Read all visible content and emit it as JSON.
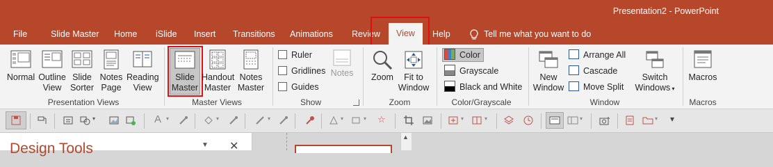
{
  "window": {
    "title": "Presentation2  -  PowerPoint"
  },
  "tabs": [
    "File",
    "Slide Master",
    "Home",
    "iSlide",
    "Insert",
    "Transitions",
    "Animations",
    "Review",
    "View",
    "Help"
  ],
  "tell_me": "Tell me what you want to do",
  "ribbon": {
    "presentation_views": {
      "label": "Presentation Views",
      "normal": "Normal",
      "outline": [
        "Outline",
        "View"
      ],
      "sorter": [
        "Slide",
        "Sorter"
      ],
      "notes_page": [
        "Notes",
        "Page"
      ],
      "reading": [
        "Reading",
        "View"
      ]
    },
    "master_views": {
      "label": "Master Views",
      "slide_master": [
        "Slide",
        "Master"
      ],
      "handout_master": [
        "Handout",
        "Master"
      ],
      "notes_master": [
        "Notes",
        "Master"
      ]
    },
    "show": {
      "label": "Show",
      "ruler": "Ruler",
      "gridlines": "Gridlines",
      "guides": "Guides",
      "notes": "Notes"
    },
    "zoom": {
      "label": "Zoom",
      "zoom": "Zoom",
      "fit": [
        "Fit to",
        "Window"
      ]
    },
    "color": {
      "label": "Color/Grayscale",
      "color": "Color",
      "grayscale": "Grayscale",
      "bw": "Black and White"
    },
    "window": {
      "label": "Window",
      "new_window": [
        "New",
        "Window"
      ],
      "arrange_all": "Arrange All",
      "cascade": "Cascade",
      "move_split": "Move Split",
      "switch": [
        "Switch",
        "Windows"
      ]
    },
    "macros": {
      "label": "Macros",
      "macros": "Macros"
    }
  },
  "pane": {
    "title": "Design Tools"
  },
  "colors": {
    "accent": "#b7472a",
    "highlight": "#e01010"
  }
}
